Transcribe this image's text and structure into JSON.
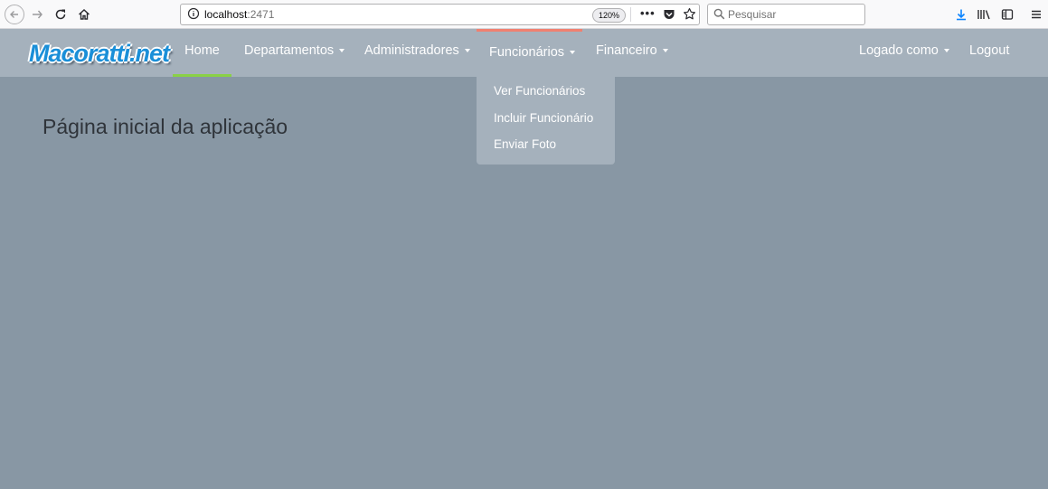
{
  "browser": {
    "url_host": "localhost",
    "url_port": ":2471",
    "zoom": "120%",
    "search_placeholder": "Pesquisar",
    "icons": [
      "back-icon",
      "forward-icon",
      "reload-icon",
      "home-icon",
      "info-icon",
      "more-icon",
      "pocket-icon",
      "star-icon",
      "search-icon",
      "download-icon",
      "library-icon",
      "sidebar-icon",
      "menu-icon"
    ]
  },
  "navbar": {
    "logo": "Macoratti.net",
    "items": [
      {
        "label": "Home",
        "dropdown": false
      },
      {
        "label": "Departamentos",
        "dropdown": true
      },
      {
        "label": "Administradores",
        "dropdown": true
      },
      {
        "label": "Funcionários",
        "dropdown": true
      },
      {
        "label": "Financeiro",
        "dropdown": true
      }
    ],
    "right": {
      "logged_as": "Logado como",
      "logout": "Logout"
    },
    "open_dropdown": {
      "items": [
        "Ver Funcionários",
        "Incluir Funcionário",
        "Enviar Foto"
      ]
    },
    "colors": {
      "navbar_bg": "#a5b1bc",
      "active_underline": "#8ad146",
      "open_topline": "#f08070",
      "page_bg": "#8897a4"
    }
  },
  "main": {
    "title": "Página inicial da aplicação"
  }
}
